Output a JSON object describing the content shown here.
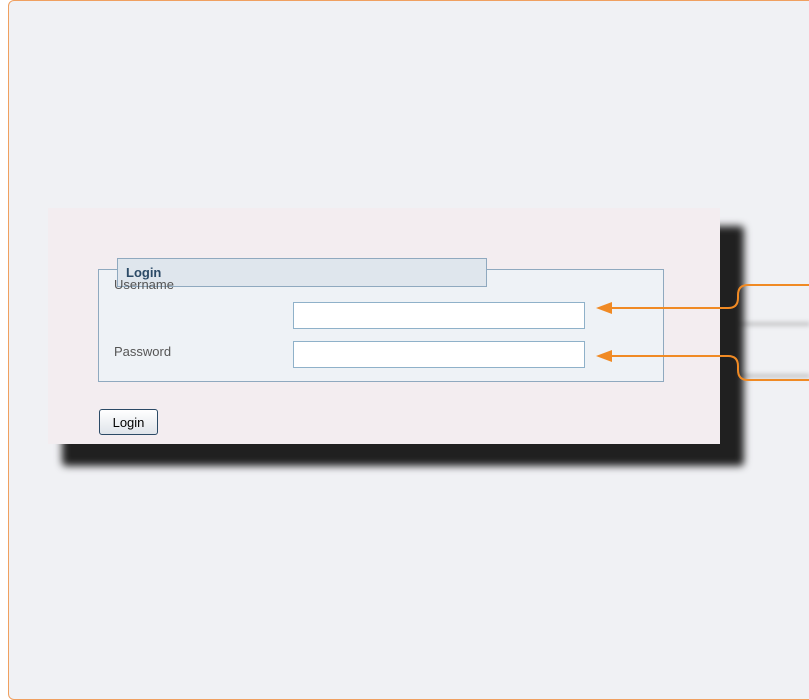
{
  "form": {
    "legend": "Login",
    "username_label": "Username",
    "username_value": "",
    "password_label": "Password",
    "password_value": "",
    "submit_label": "Login"
  },
  "colors": {
    "callout_arrow": "#f08a24",
    "frame_border": "#f0a060",
    "fieldset_border": "#8fa9bf"
  }
}
